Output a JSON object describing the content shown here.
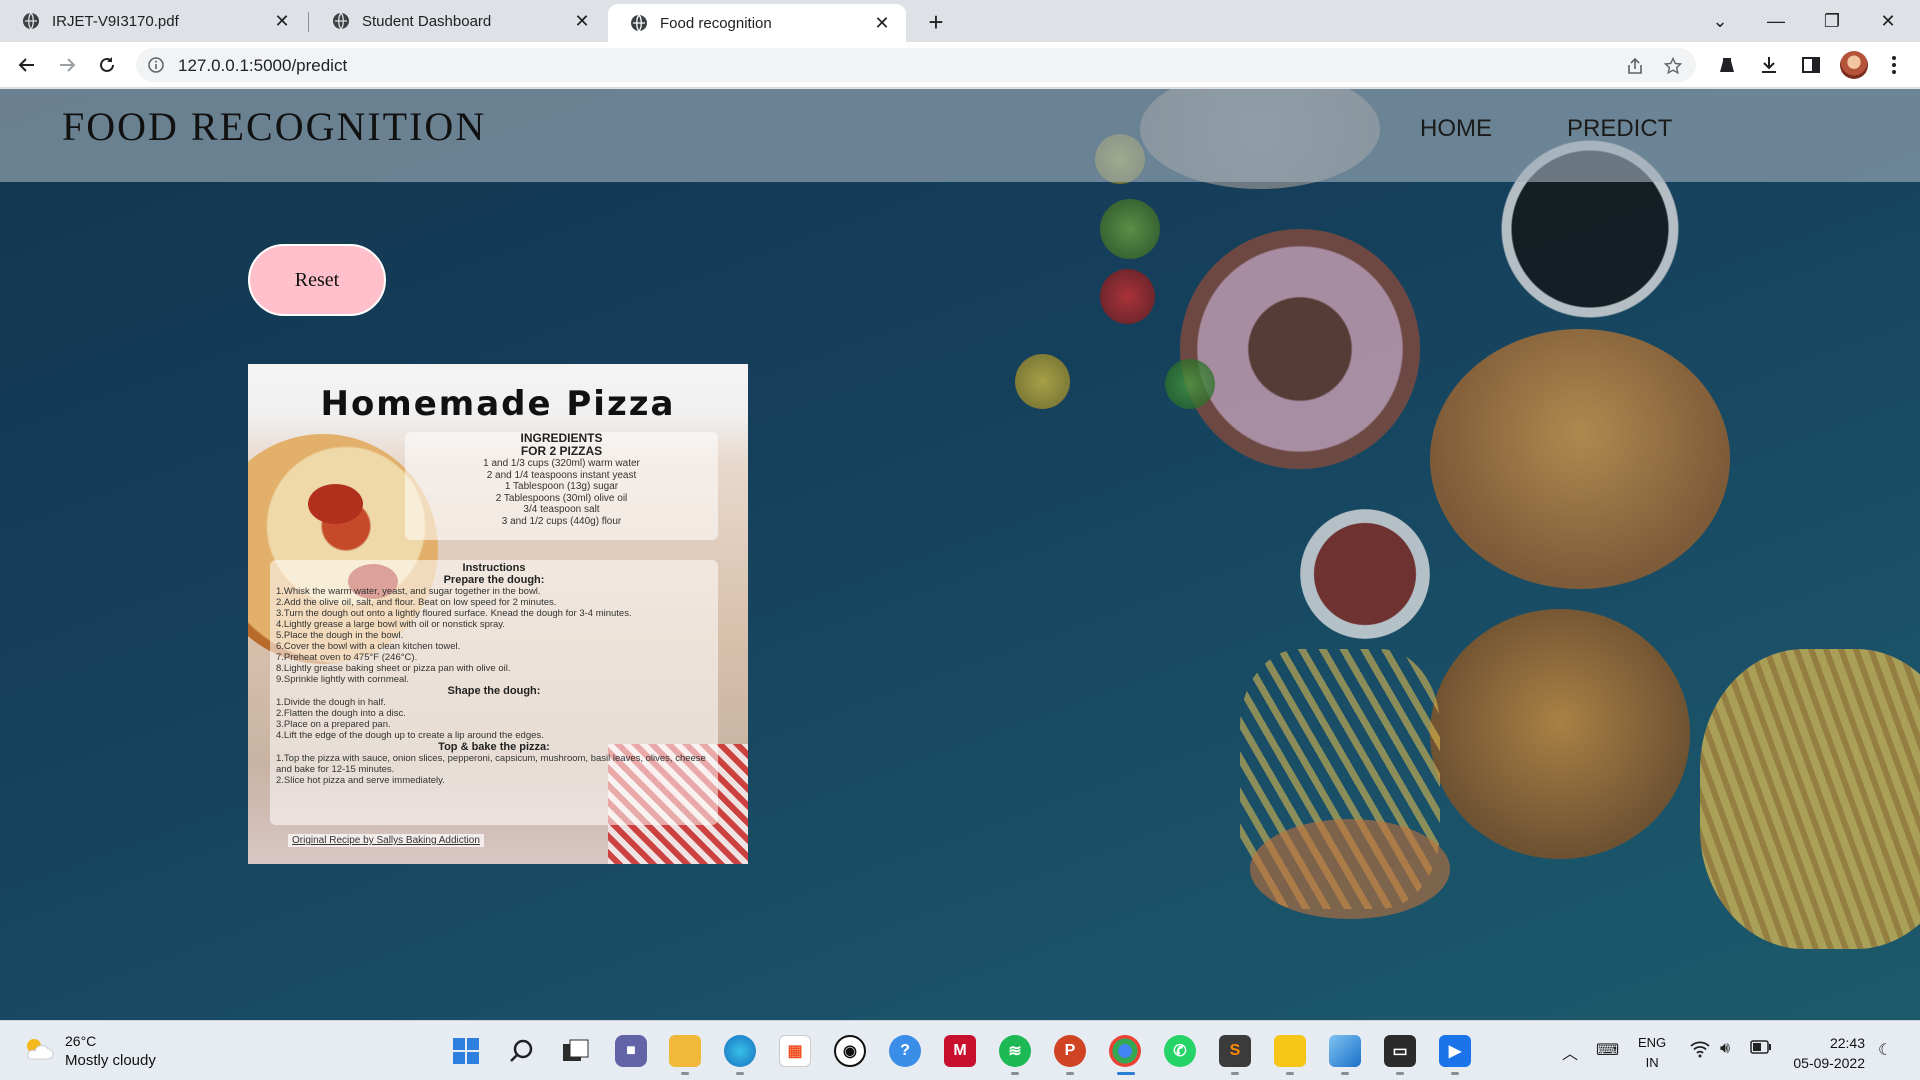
{
  "browser": {
    "tabs": [
      {
        "label": "IRJET-V9I3170.pdf",
        "active": false
      },
      {
        "label": "Student Dashboard",
        "active": false
      },
      {
        "label": "Food recognition",
        "active": true
      }
    ],
    "url": "127.0.0.1:5000/predict"
  },
  "site": {
    "brand": "FOOD RECOGNITION",
    "nav": {
      "home": "HOME",
      "predict": "PREDICT"
    },
    "reset_label": "Reset"
  },
  "recipe_image": {
    "title": "Homemade Pizza",
    "ingredients_heading": "INGREDIENTS",
    "ingredients_sub": "FOR 2 PIZZAS",
    "ingredients": [
      "1 and 1/3 cups (320ml) warm water",
      "2 and 1/4 teaspoons instant yeast",
      "1 Tablespoon (13g) sugar",
      "2 Tablespoons (30ml) olive oil",
      "3/4 teaspoon salt",
      "3 and 1/2 cups (440g) flour"
    ],
    "instructions_heading": "Instructions",
    "sections": [
      {
        "heading": "Prepare the dough:",
        "steps": [
          "1.Whisk the warm water, yeast, and sugar together in the bowl.",
          "2.Add the olive oil, salt, and flour. Beat on low speed for 2 minutes.",
          "3.Turn the dough out onto a lightly floured surface. Knead the dough for 3-4 minutes.",
          "4.Lightly grease a large bowl with oil or nonstick spray.",
          "5.Place the dough in the bowl.",
          "6.Cover the bowl with a clean kitchen towel.",
          "7.Preheat oven to 475°F (246°C).",
          "8.Lightly grease baking sheet or pizza pan with olive oil.",
          "9.Sprinkle lightly with cornmeal."
        ]
      },
      {
        "heading": "Shape the dough:",
        "steps": [
          "1.Divide the dough in half.",
          "2.Flatten the dough into a disc.",
          "3.Place on a prepared pan.",
          "4.Lift the edge of the dough up to create a lip around the edges."
        ]
      },
      {
        "heading": "Top & bake the pizza:",
        "steps": [
          "1.Top the pizza with sauce, onion slices, pepperoni, capsicum, mushroom, basil leaves, olives, cheese and bake for 12-15 minutes.",
          "2.Slice hot pizza and serve immediately."
        ]
      }
    ],
    "credit": "Original Recipe by Sallys Baking Addiction"
  },
  "taskbar": {
    "temperature": "26°C",
    "condition": "Mostly cloudy",
    "language": "ENG",
    "region": "IN",
    "time": "22:43",
    "date": "05-09-2022",
    "apps": [
      "windows-icon",
      "search-icon",
      "task-view-icon",
      "chat-icon",
      "file-explorer-icon",
      "edge-icon",
      "store-icon",
      "github-icon",
      "help-icon",
      "mcafee-icon",
      "spotify-icon",
      "powerpoint-icon",
      "chrome-beta-icon",
      "whatsapp-icon",
      "sublime-icon",
      "files-icon",
      "photos-icon",
      "terminal-icon",
      "media-player-icon"
    ]
  },
  "colors": {
    "reset_button": "#ffc0cb",
    "page_background": "#15405c",
    "header_overlay": "#a0afb9"
  }
}
